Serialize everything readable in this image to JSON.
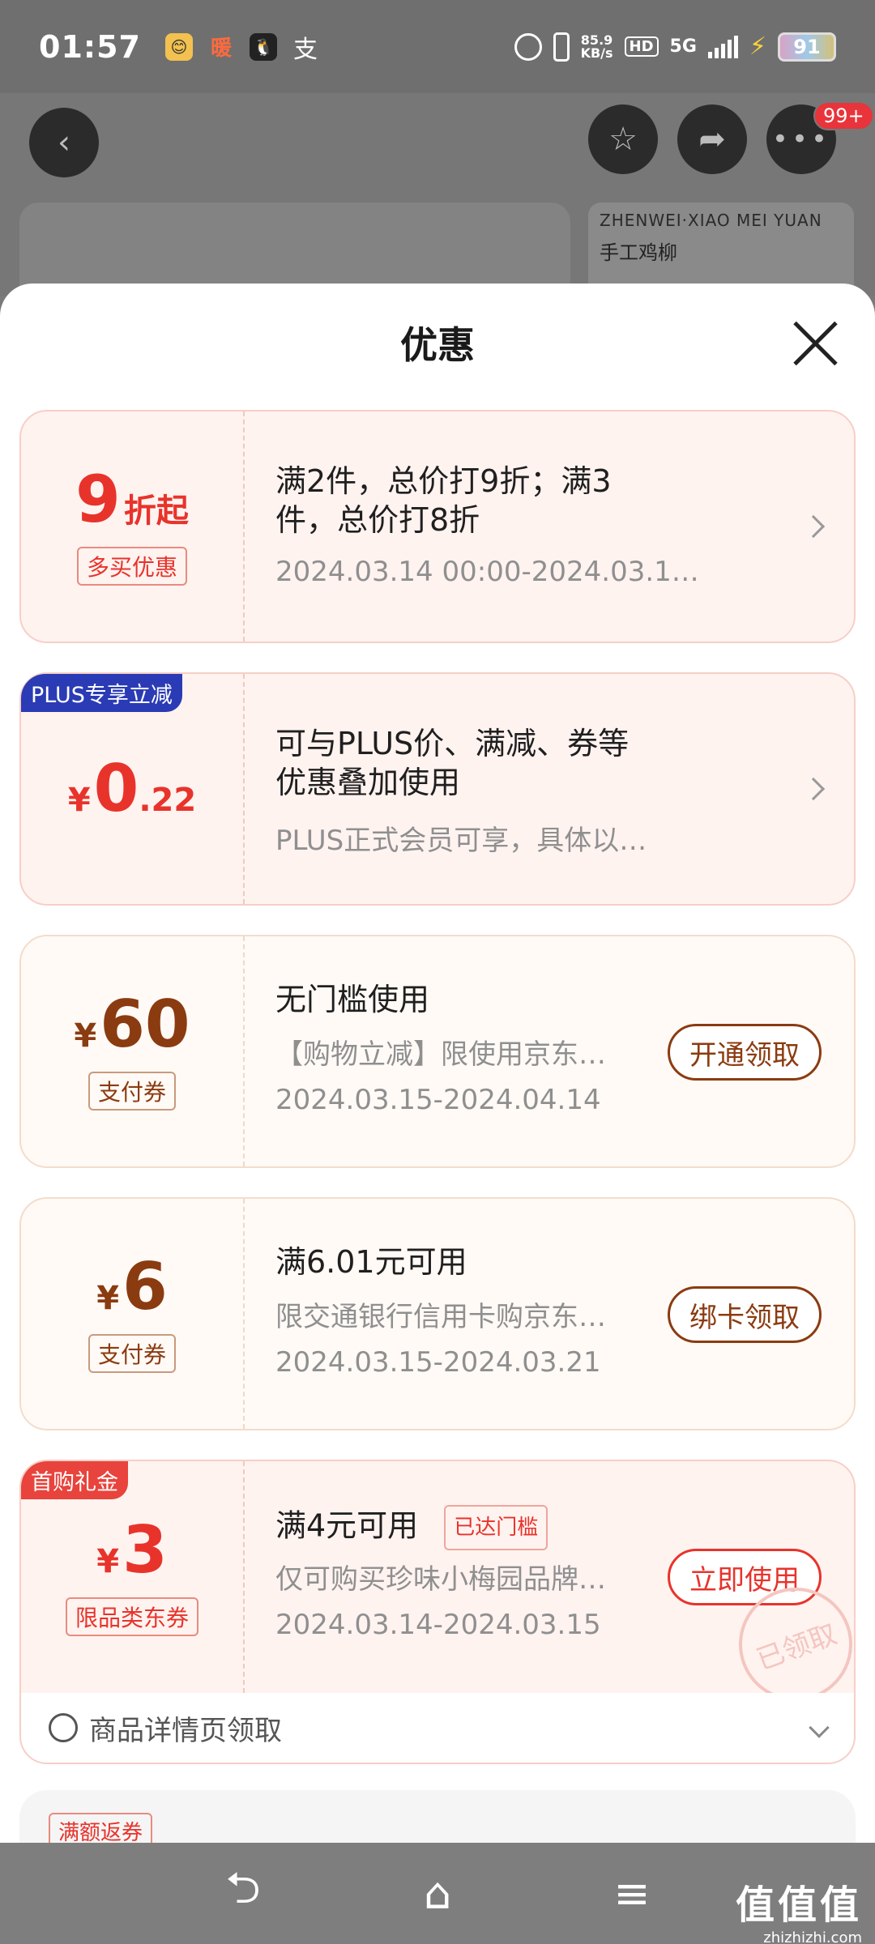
{
  "status": {
    "time": "01:57",
    "app_icons": [
      "😊",
      "暖",
      "🐧",
      "支"
    ],
    "speed_top": "85.9",
    "speed_unit": "KB/s",
    "hd": "HD",
    "network": "5G",
    "battery": "91"
  },
  "page": {
    "badge": "99+",
    "promo_en": "ZHENWEI·XIAO MEI YUAN",
    "promo_cn": "手工鸡柳"
  },
  "sheet": {
    "title": "优惠"
  },
  "offers": [
    {
      "amount": "9",
      "unit": "折起",
      "tag": "多买优惠",
      "title_line1": "满2件，总价打9折；满3",
      "title_line2": "件，总价打8折",
      "sub": "2024.03.14 00:00-2024.03.1…"
    },
    {
      "corner": "PLUS专享立减",
      "currency": "¥",
      "amount": "0",
      "decimal": ".22",
      "title_line1": "可与PLUS价、满减、券等",
      "title_line2": "优惠叠加使用",
      "sub": "PLUS正式会员可享，具体以…"
    },
    {
      "currency": "¥",
      "amount": "60",
      "tag": "支付券",
      "title": "无门槛使用",
      "desc": "【购物立减】限使用京东…",
      "date": "2024.03.15-2024.04.14",
      "button": "开通领取"
    },
    {
      "currency": "¥",
      "amount": "6",
      "tag": "支付券",
      "title": "满6.01元可用",
      "desc": "限交通银行信用卡购京东…",
      "date": "2024.03.15-2024.03.21",
      "button": "绑卡领取"
    },
    {
      "corner": "首购礼金",
      "currency": "¥",
      "amount": "3",
      "tag": "限品类东券",
      "title": "满4元可用",
      "reached": "已达门槛",
      "desc": "仅可购买珍味小梅园品牌…",
      "date": "2024.03.14-2024.03.15",
      "button": "立即使用",
      "stamp": "已领取"
    }
  ],
  "detail": {
    "text": "商品详情页领取"
  },
  "next": {
    "tag": "满额返券"
  },
  "watermark": {
    "line1": "值值值",
    "line2": "zhizhizhi.com"
  }
}
